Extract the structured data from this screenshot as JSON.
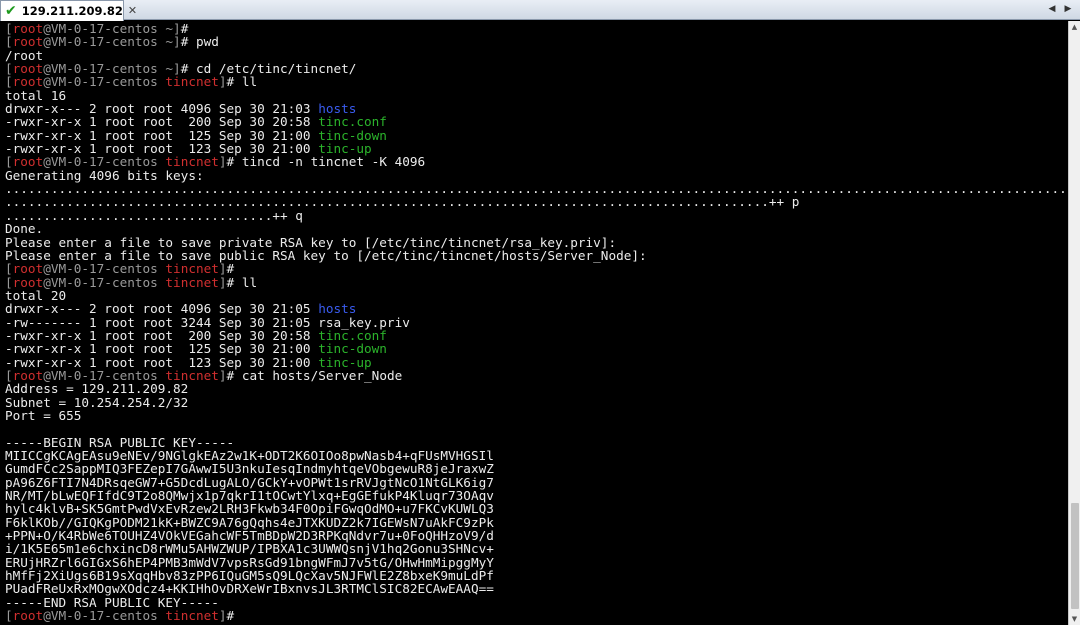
{
  "tab": {
    "title": "129.211.209.82",
    "status_icon": "checkmark-icon",
    "close_label": "✕"
  },
  "tab_nav": {
    "left": "◀",
    "right": "▶"
  },
  "scroll": {
    "up": "▲",
    "down": "▼"
  },
  "terminal": {
    "lines": [
      [
        [
          "gray",
          "["
        ],
        [
          "red",
          "root"
        ],
        [
          "gray",
          "@VM-0-17-centos ~]"
        ],
        [
          "white",
          "#"
        ]
      ],
      [
        [
          "gray",
          "["
        ],
        [
          "red",
          "root"
        ],
        [
          "gray",
          "@VM-0-17-centos ~]"
        ],
        [
          "white",
          "# pwd"
        ]
      ],
      [
        [
          "white",
          "/root"
        ]
      ],
      [
        [
          "gray",
          "["
        ],
        [
          "red",
          "root"
        ],
        [
          "gray",
          "@VM-0-17-centos ~]"
        ],
        [
          "white",
          "# cd /etc/tinc/tincnet/"
        ]
      ],
      [
        [
          "gray",
          "["
        ],
        [
          "red",
          "root"
        ],
        [
          "gray",
          "@VM-0-17-centos "
        ],
        [
          "red",
          "tincnet"
        ],
        [
          "gray",
          "]"
        ],
        [
          "white",
          "# ll"
        ]
      ],
      [
        [
          "white",
          "total 16"
        ]
      ],
      [
        [
          "white",
          "drwxr-x--- 2 root root 4096 Sep 30 21:03 "
        ],
        [
          "blue",
          "hosts"
        ]
      ],
      [
        [
          "white",
          "-rwxr-xr-x 1 root root  200 Sep 30 20:58 "
        ],
        [
          "green",
          "tinc.conf"
        ]
      ],
      [
        [
          "white",
          "-rwxr-xr-x 1 root root  125 Sep 30 21:00 "
        ],
        [
          "green",
          "tinc-down"
        ]
      ],
      [
        [
          "white",
          "-rwxr-xr-x 1 root root  123 Sep 30 21:00 "
        ],
        [
          "green",
          "tinc-up"
        ]
      ],
      [
        [
          "gray",
          "["
        ],
        [
          "red",
          "root"
        ],
        [
          "gray",
          "@VM-0-17-centos "
        ],
        [
          "red",
          "tincnet"
        ],
        [
          "gray",
          "]"
        ],
        [
          "white",
          "# tincd -n tincnet -K 4096"
        ]
      ],
      [
        [
          "white",
          "Generating 4096 bits keys:"
        ]
      ],
      [
        [
          "white",
          "................................................................................................................................................................................................................................................................."
        ]
      ],
      [
        [
          "white",
          "....................................................................................................++ p"
        ]
      ],
      [
        [
          "white",
          "...................................++ q"
        ]
      ],
      [
        [
          "white",
          "Done."
        ]
      ],
      [
        [
          "white",
          "Please enter a file to save private RSA key to [/etc/tinc/tincnet/rsa_key.priv]:"
        ]
      ],
      [
        [
          "white",
          "Please enter a file to save public RSA key to [/etc/tinc/tincnet/hosts/Server_Node]:"
        ]
      ],
      [
        [
          "gray",
          "["
        ],
        [
          "red",
          "root"
        ],
        [
          "gray",
          "@VM-0-17-centos "
        ],
        [
          "red",
          "tincnet"
        ],
        [
          "gray",
          "]"
        ],
        [
          "white",
          "#"
        ]
      ],
      [
        [
          "gray",
          "["
        ],
        [
          "red",
          "root"
        ],
        [
          "gray",
          "@VM-0-17-centos "
        ],
        [
          "red",
          "tincnet"
        ],
        [
          "gray",
          "]"
        ],
        [
          "white",
          "# ll"
        ]
      ],
      [
        [
          "white",
          "total 20"
        ]
      ],
      [
        [
          "white",
          "drwxr-x--- 2 root root 4096 Sep 30 21:05 "
        ],
        [
          "blue",
          "hosts"
        ]
      ],
      [
        [
          "white",
          "-rw------- 1 root root 3244 Sep 30 21:05 rsa_key.priv"
        ]
      ],
      [
        [
          "white",
          "-rwxr-xr-x 1 root root  200 Sep 30 20:58 "
        ],
        [
          "green",
          "tinc.conf"
        ]
      ],
      [
        [
          "white",
          "-rwxr-xr-x 1 root root  125 Sep 30 21:00 "
        ],
        [
          "green",
          "tinc-down"
        ]
      ],
      [
        [
          "white",
          "-rwxr-xr-x 1 root root  123 Sep 30 21:00 "
        ],
        [
          "green",
          "tinc-up"
        ]
      ],
      [
        [
          "gray",
          "["
        ],
        [
          "red",
          "root"
        ],
        [
          "gray",
          "@VM-0-17-centos "
        ],
        [
          "red",
          "tincnet"
        ],
        [
          "gray",
          "]"
        ],
        [
          "white",
          "# cat hosts/Server_Node"
        ]
      ],
      [
        [
          "white",
          "Address = 129.211.209.82"
        ]
      ],
      [
        [
          "white",
          "Subnet = 10.254.254.2/32"
        ]
      ],
      [
        [
          "white",
          "Port = 655"
        ]
      ],
      [
        [
          "white",
          ""
        ]
      ],
      [
        [
          "white",
          "-----BEGIN RSA PUBLIC KEY-----"
        ]
      ],
      [
        [
          "white",
          "MIICCgKCAgEAsu9eNEv/9NGlgkEAz2w1K+ODT2K6OIOo8pwNasb4+qFUsMVHGSIl"
        ]
      ],
      [
        [
          "white",
          "GumdFCc2SappMIQ3FEZepI7GAwwI5U3nkuIesqIndmyhtqeVObgewuR8jeJraxwZ"
        ]
      ],
      [
        [
          "white",
          "pA96Z6FTI7N4DRsqeGW7+G5DcdLugALO/GCkY+vOPWt1srRVJgtNcO1NtGLK6ig7"
        ]
      ],
      [
        [
          "white",
          "NR/MT/bLwEQFIfdC9T2o8QMwjx1p7qkrI1tOCwtYlxq+EgGEfukP4Kluqr73OAqv"
        ]
      ],
      [
        [
          "white",
          "hylc4klvB+SK5GmtPwdVxEvRzew2LRH3Fkwb34F0OpiFGwqOdMO+u7FKCvKUWLQ3"
        ]
      ],
      [
        [
          "white",
          "F6klKOb//GIQKgPODM21kK+BWZC9A76gQqhs4eJTXKUDZ2k7IGEWsN7uAkFC9zPk"
        ]
      ],
      [
        [
          "white",
          "+PPN+O/K4RbWe6TOUHZ4VOkVEGahcWF5TmBDpW2D3RPKqNdvr7u+0FoQHHzoV9/d"
        ]
      ],
      [
        [
          "white",
          "i/1K5E65m1e6chxincD8rWMu5AHWZWUP/IPBXA1c3UWWQsnjV1hq2Gonu3SHNcv+"
        ]
      ],
      [
        [
          "white",
          "ERUjHRZrl6GIGxS6hEP4PMB3mWdV7vpsRsGd91bngWFmJ7v5tG/OHwHmMipggMyY"
        ]
      ],
      [
        [
          "white",
          "hMfFj2XiUgs6B19sXqqHbv83zPP6IQuGM5sQ9LQcXav5NJFWlE2Z8bxeK9muLdPf"
        ]
      ],
      [
        [
          "white",
          "PUadFReUxRxMOgwXOdcz4+KKIHhOvDRXeWrIBxnvsJL3RTMClSIC82ECAwEAAQ=="
        ]
      ],
      [
        [
          "white",
          "-----END RSA PUBLIC KEY-----"
        ]
      ],
      [
        [
          "gray",
          "["
        ],
        [
          "red",
          "root"
        ],
        [
          "gray",
          "@VM-0-17-centos "
        ],
        [
          "red",
          "tincnet"
        ],
        [
          "gray",
          "]"
        ],
        [
          "white",
          "#"
        ]
      ]
    ]
  }
}
